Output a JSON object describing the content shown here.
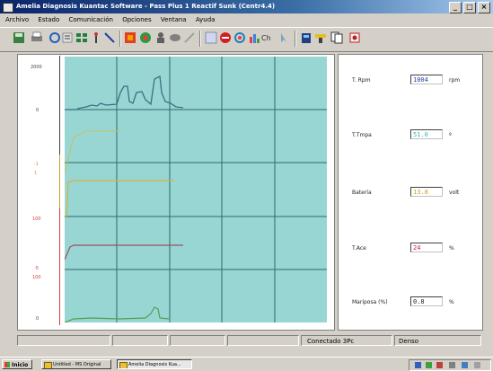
{
  "window": {
    "title": "Amelia Diagnosis Kuantac Software - Pass Plus 1 Reactif Sunk (Centr4.4)"
  },
  "menu": [
    "Archivo",
    "Estado",
    "Comunicación",
    "Opciones",
    "Ventana",
    "Ayuda"
  ],
  "toolbar_icons": [
    "save-icon",
    "print-icon",
    "refresh-icon",
    "list-icon",
    "grid-icon",
    "probe-icon",
    "pen-icon",
    "stop-red-icon",
    "record-green-icon",
    "person-icon",
    "disk-icon",
    "wrench-icon",
    "zoom-icon",
    "stop-icon",
    "cycle-icon",
    "chart-icon",
    "ch-icon",
    "pointer-icon",
    "battery-icon",
    "connect-icon",
    "copy-icon",
    "exit-icon"
  ],
  "axis": {
    "ticks": [
      {
        "label": "2000"
      },
      {
        "label": "0"
      },
      {
        "label": "-1"
      },
      {
        "label": "1"
      },
      {
        "label": "100"
      },
      {
        "label": "-5"
      },
      {
        "label": "100"
      },
      {
        "label": "0"
      }
    ]
  },
  "colors": {
    "plot_bg": "#98d6d4",
    "grid": "#2d6a6a",
    "series_rpm": "#3a7080",
    "series_temp": "#c8c060",
    "series_battery": "#d8b040",
    "series_tps": "#a05060",
    "series_map": "#50a050",
    "axis_red": "#d04040",
    "axis_yellow": "#c8a030"
  },
  "readings": [
    {
      "label": "T. Rpm",
      "value": "1004",
      "unit": "rpm",
      "color": "#2040a0"
    },
    {
      "label": "T.Tmpa",
      "value": "51.0",
      "unit": "º",
      "color": "#40b0c0"
    },
    {
      "label": "Batería",
      "value": "13.8",
      "unit": "volt",
      "color": "#c8a020"
    },
    {
      "label": "T.Ace",
      "value": "24",
      "unit": "%",
      "color": "#c02040"
    },
    {
      "label": "Mariposa (%)",
      "value": "0.8",
      "unit": "%",
      "color": "#202020"
    }
  ],
  "status": {
    "cells": [
      "",
      "",
      "",
      "",
      "Conectado 3Pc",
      "Denso"
    ]
  },
  "taskbar": {
    "start_label": "Inicio",
    "tasks": [
      "Untitled - MS Original",
      "Amelia Diagnosis Kua..."
    ],
    "active_task": 1
  }
}
